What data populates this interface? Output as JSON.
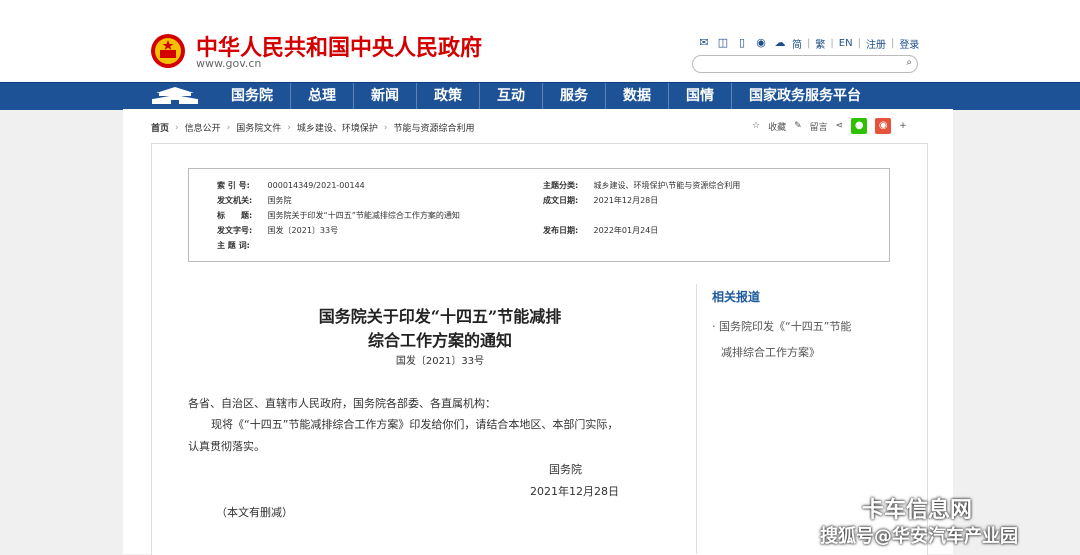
{
  "header": {
    "site_title": "中华人民共和国中央人民政府",
    "site_url": "www.gov.cn",
    "utility": {
      "simplified": "简",
      "traditional": "繁",
      "english": "EN",
      "register": "注册",
      "login": "登录"
    },
    "search_placeholder": ""
  },
  "nav": {
    "items": [
      "国务院",
      "总理",
      "新闻",
      "政策",
      "互动",
      "服务",
      "数据",
      "国情",
      "国家政务服务平台"
    ]
  },
  "breadcrumb": {
    "home": "首页",
    "items": [
      "信息公开",
      "国务院文件",
      "城乡建设、环境保护",
      "节能与资源综合利用"
    ]
  },
  "tools": {
    "favorite": "收藏",
    "comment": "留言",
    "plus": "+"
  },
  "meta": {
    "index_label": "索 引 号:",
    "index_value": "000014349/2021-00144",
    "org_label": "发文机关:",
    "org_value": "国务院",
    "title_label": "标　　题:",
    "title_value": "国务院关于印发“十四五”节能减排综合工作方案的通知",
    "docnum_label": "发文字号:",
    "docnum_value": "国发〔2021〕33号",
    "keywords_label": "主 题 词:",
    "keywords_value": "",
    "category_label": "主题分类:",
    "category_value": "城乡建设、环境保护\\节能与资源综合利用",
    "created_label": "成文日期:",
    "created_value": "2021年12月28日",
    "published_label": "发布日期:",
    "published_value": "2022年01月24日"
  },
  "article": {
    "title_line1": "国务院关于印发“十四五”节能减排",
    "title_line2": "综合工作方案的通知",
    "doc_number": "国发〔2021〕33号",
    "salutation": "各省、自治区、直辖市人民政府，国务院各部委、各直属机构：",
    "body_line1": "现将《“十四五”节能减排综合工作方案》印发给你们，请结合本地区、本部门实际，",
    "body_line2": "认真贯彻落实。",
    "signature": "国务院",
    "date": "2021年12月28日",
    "note": "（本文有删减）"
  },
  "related": {
    "heading": "相关报道",
    "item_line1": "· 国务院印发《“十四五”节能",
    "item_line2": "减排综合工作方案》"
  },
  "watermark": {
    "line1": "卡车信息网",
    "line2": "搜狐号@华安汽车产业园"
  }
}
